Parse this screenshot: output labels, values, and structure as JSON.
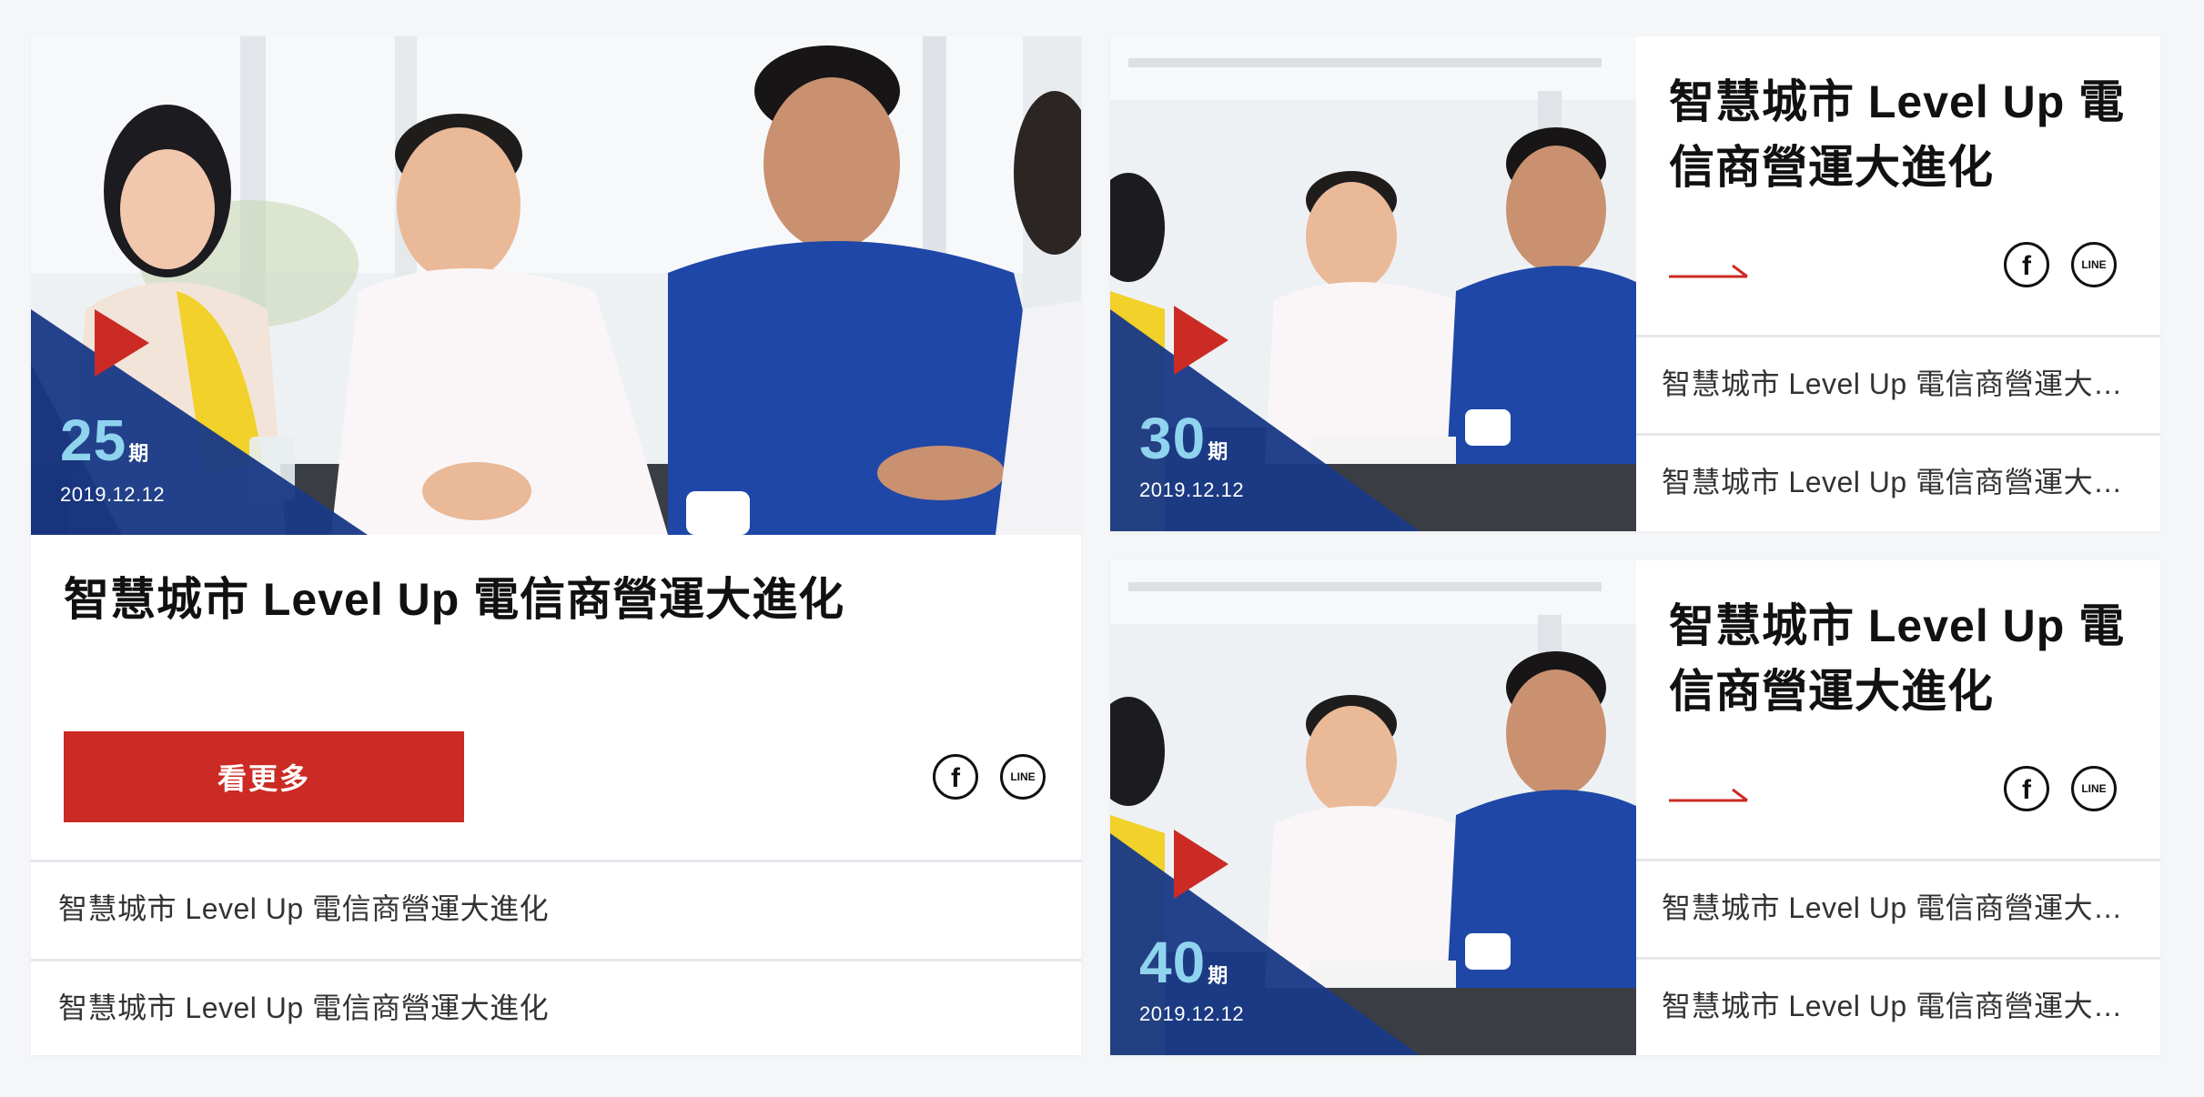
{
  "featured": {
    "issue_number": "25",
    "issue_unit": "期",
    "date": "2019.12.12",
    "title": "智慧城市 Level Up 電信商營運大進化",
    "more_label": "看更多",
    "list": [
      "智慧城市 Level Up 電信商營運大進化",
      "智慧城市 Level Up 電信商營運大進化"
    ]
  },
  "cards": [
    {
      "issue_number": "30",
      "issue_unit": "期",
      "date": "2019.12.12",
      "title": "智慧城市 Level Up 電信商營運大進化",
      "list": [
        "智慧城市 Level Up 電信商營運大進化",
        "智慧城市 Level Up 電信商營運大進化"
      ]
    },
    {
      "issue_number": "40",
      "issue_unit": "期",
      "date": "2019.12.12",
      "title": "智慧城市 Level Up 電信商營運大進化",
      "list": [
        "智慧城市 Level Up 電信商營運大進化",
        "智慧城市 Level Up 電信商營運大進化"
      ]
    }
  ],
  "share": {
    "facebook_glyph": "f",
    "line_glyph": "LINE"
  },
  "icons": {
    "facebook": "facebook-icon",
    "line": "line-icon",
    "arrow": "arrow-right-icon",
    "play": "play-triangle-icon"
  },
  "colors": {
    "accent_red": "#cc2a24",
    "navy": "#1a3a86",
    "issue_number": "#8fd3ef",
    "shirt_blue": "#1e47a8"
  }
}
